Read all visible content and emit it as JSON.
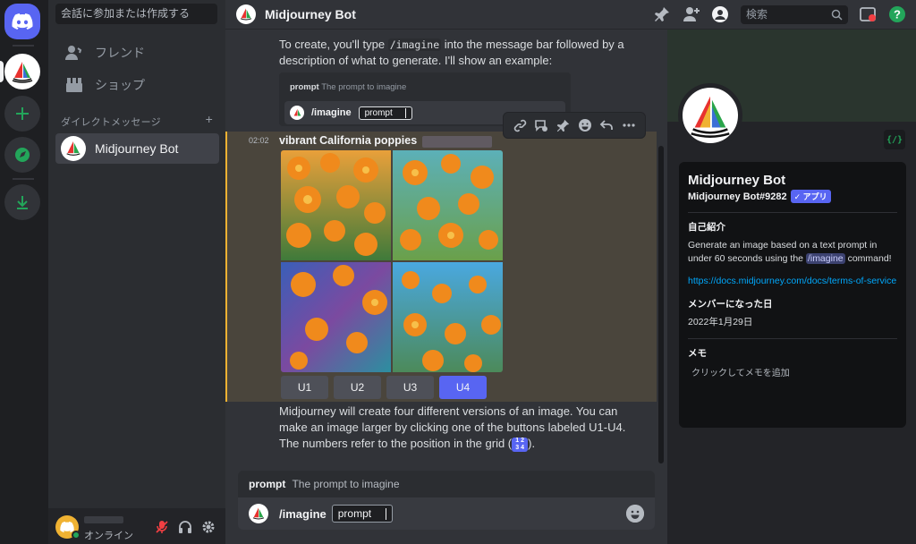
{
  "sidebar": {
    "search_placeholder": "会話に参加または作成する",
    "friends_label": "フレンド",
    "shop_label": "ショップ",
    "dm_header": "ダイレクトメッセージ",
    "dm_add": "+",
    "dm_items": [
      {
        "name": "Midjourney Bot"
      }
    ]
  },
  "user_panel": {
    "status": "オンライン"
  },
  "header": {
    "title": "Midjourney Bot",
    "search_placeholder": "検索"
  },
  "chat": {
    "intro_text_1": "To create, you'll type",
    "intro_code": "/imagine",
    "intro_text_2": "into the message bar followed by a description of what to generate. I'll show an example:",
    "example": {
      "hint_label": "prompt",
      "hint_text": "The prompt to imagine",
      "command": "/imagine",
      "chip": "prompt"
    },
    "message": {
      "time": "02:02",
      "title": "vibrant California poppies",
      "buttons": [
        "U1",
        "U2",
        "U3",
        "U4"
      ],
      "active_button": "U4"
    },
    "outro_text": "Midjourney will create four different versions of an image. You can make an image larger by clicking one of the buttons labeled U1-U4. The numbers refer to the position in the grid (",
    "outro_end": ").",
    "grid_badge_top": "1 2",
    "grid_badge_bottom": "3 4"
  },
  "composer": {
    "hint_label": "prompt",
    "hint_text": "The prompt to imagine",
    "command": "/imagine",
    "chip": "prompt"
  },
  "profile": {
    "name": "Midjourney Bot",
    "tag": "Midjourney Bot#9282",
    "app_badge": "✓ アプリ",
    "dev_badge": "{/}",
    "about_heading": "自己紹介",
    "about_text_1": "Generate an image based on a text prompt in under 60 seconds using the",
    "about_cmd": "/imagine",
    "about_text_2": "command!",
    "link": "https://docs.midjourney.com/docs/terms-of-service",
    "member_since_heading": "メンバーになった日",
    "member_since": "2022年1月29日",
    "note_heading": "メモ",
    "note_placeholder": "クリックしてメモを追加"
  },
  "colors": {
    "accent": "#5865f2",
    "online": "#23a55a",
    "highlight": "#f0b232",
    "link": "#00a8fc"
  }
}
